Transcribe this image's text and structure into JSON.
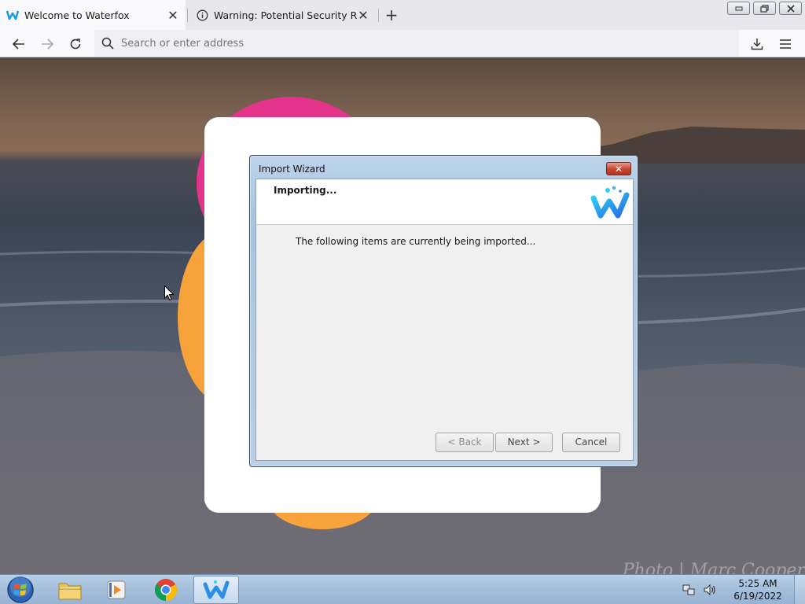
{
  "browser": {
    "tabs": [
      {
        "title": "Welcome to Waterfox",
        "active": true
      },
      {
        "title": "Warning: Potential Security Risk Ahead",
        "active": false
      }
    ],
    "url_placeholder": "Search or enter address"
  },
  "page": {
    "watermark": "Photo | Marc Cooper"
  },
  "dialog": {
    "title": "Import Wizard",
    "heading": "Importing...",
    "message": "The following items are currently being imported...",
    "buttons": {
      "back": "< Back",
      "next": "Next >",
      "cancel": "Cancel"
    }
  },
  "taskbar": {
    "items": [
      "start-orb",
      "file-explorer",
      "media-player",
      "chrome",
      "waterfox"
    ],
    "clock_time": "5:25 AM",
    "clock_date": "6/19/2022"
  },
  "colors": {
    "accent_pink": "#e3338b",
    "accent_orange": "#f7a23a",
    "dialog_frame": "#a9c5e2"
  }
}
